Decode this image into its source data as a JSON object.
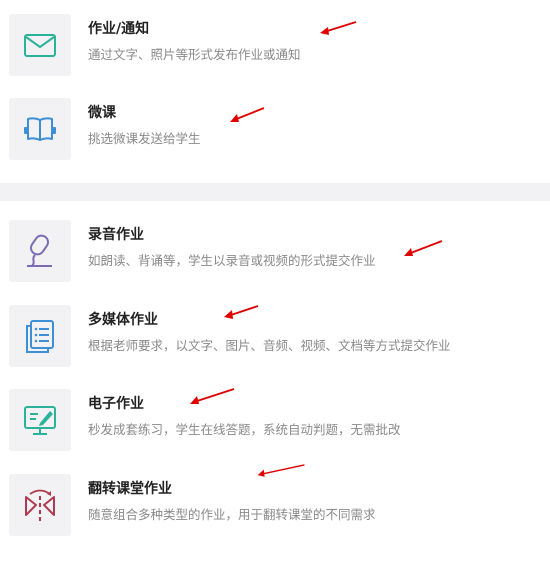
{
  "sections": [
    {
      "items": [
        {
          "title": "作业/通知",
          "desc": "通过文字、照片等形式发布作业或通知",
          "icon": "envelope-icon",
          "accent": "#2bb39a"
        },
        {
          "title": "微课",
          "desc": "挑选微课发送给学生",
          "icon": "book-icon",
          "accent": "#3d8fd6"
        }
      ]
    },
    {
      "items": [
        {
          "title": "录音作业",
          "desc": "如朗读、背诵等，学生以录音或视频的形式提交作业",
          "icon": "microphone-icon",
          "accent": "#7b6bb5"
        },
        {
          "title": "多媒体作业",
          "desc": "根据老师要求，以文字、图片、音频、视频、文档等方式提交作业",
          "icon": "document-list-icon",
          "accent": "#3d8fd6"
        },
        {
          "title": "电子作业",
          "desc": "秒发成套练习，学生在线答题，系统自动判题，无需批改",
          "icon": "monitor-pen-icon",
          "accent": "#2bb39a"
        },
        {
          "title": "翻转课堂作业",
          "desc": "随意组合多种类型的作业，用于翻转课堂的不同需求",
          "icon": "flip-icon",
          "accent": "#b03a4f"
        }
      ]
    }
  ],
  "colors": {
    "arrow": "#e00000",
    "tile_bg": "#f2f2f4",
    "divider": "#f2f2f5",
    "title": "#222222",
    "desc": "#8a8a8a"
  }
}
